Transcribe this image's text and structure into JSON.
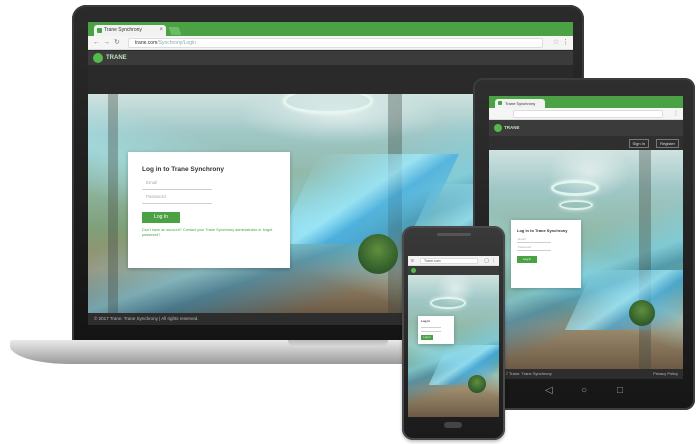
{
  "laptop": {
    "tab_title": "Trane Synchrony",
    "url_host": "trane.com",
    "url_path": "/Synchrony/Login",
    "logo_text": "TRANE",
    "login": {
      "title": "Log in to Trane Synchrony",
      "username_placeholder": "Email",
      "password_placeholder": "Password",
      "button_label": "Log In",
      "help_text": "Don't have an account? Contact your Trane Synchrony administrator or forgot password?"
    },
    "footer_text": "© 2017 Trane. Trane Synchrony | All rights reserved."
  },
  "tablet": {
    "tab_title": "Trane Synchrony",
    "logo_text": "TRANE",
    "header_buttons": [
      "Sign In",
      "Register"
    ],
    "login": {
      "title": "Log in to Trane Synchrony",
      "username_placeholder": "Email",
      "password_placeholder": "Password",
      "button_label": "Log In"
    },
    "footer_left": "© 2017 Trane. Trane Synchrony",
    "footer_right": "Privacy Policy",
    "nav_icons": [
      "back-icon",
      "home-icon",
      "recent-apps-icon"
    ]
  },
  "phone": {
    "url_text": "Trane.com",
    "login": {
      "title": "Log in",
      "button_label": "Log In"
    }
  },
  "colors": {
    "brand_green": "#4aa244",
    "header_dark": "#3b3b3b",
    "device_black": "#1a1a1a"
  }
}
